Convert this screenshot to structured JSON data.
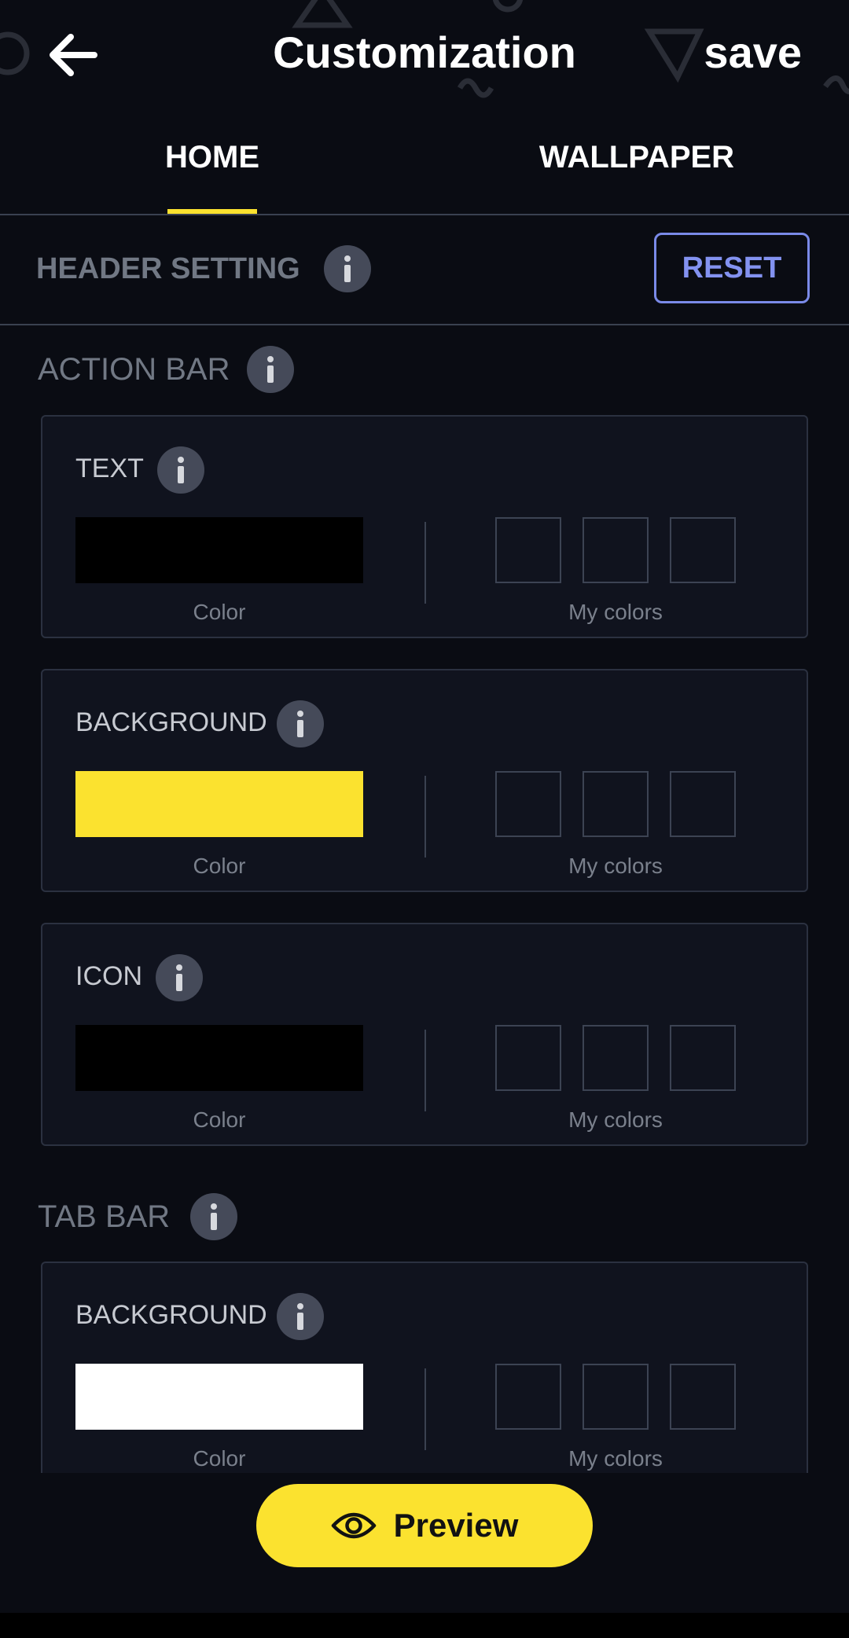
{
  "header": {
    "title": "Customization",
    "save_label": "save",
    "back_icon": "arrow-left-icon"
  },
  "tabs": [
    {
      "label": "HOME",
      "active": true
    },
    {
      "label": "WALLPAPER",
      "active": false
    }
  ],
  "header_setting": {
    "label": "HEADER SETTING",
    "reset_label": "RESET"
  },
  "sections": {
    "action_bar": {
      "label": "ACTION BAR",
      "cards": [
        {
          "label": "TEXT",
          "color": "#000000",
          "color_caption": "Color",
          "mycolors_caption": "My colors"
        },
        {
          "label": "BACKGROUND",
          "color": "#fbe22f",
          "color_caption": "Color",
          "mycolors_caption": "My colors"
        },
        {
          "label": "ICON",
          "color": "#000000",
          "color_caption": "Color",
          "mycolors_caption": "My colors"
        }
      ]
    },
    "tab_bar": {
      "label": "TAB BAR",
      "cards": [
        {
          "label": "BACKGROUND",
          "color": "#ffffff",
          "color_caption": "Color",
          "mycolors_caption": "My colors"
        }
      ]
    }
  },
  "preview": {
    "label": "Preview",
    "icon": "eye-icon"
  },
  "colors": {
    "accent": "#fbe22f",
    "reset_border": "#7a8ae8",
    "background": "#0a0c13"
  }
}
